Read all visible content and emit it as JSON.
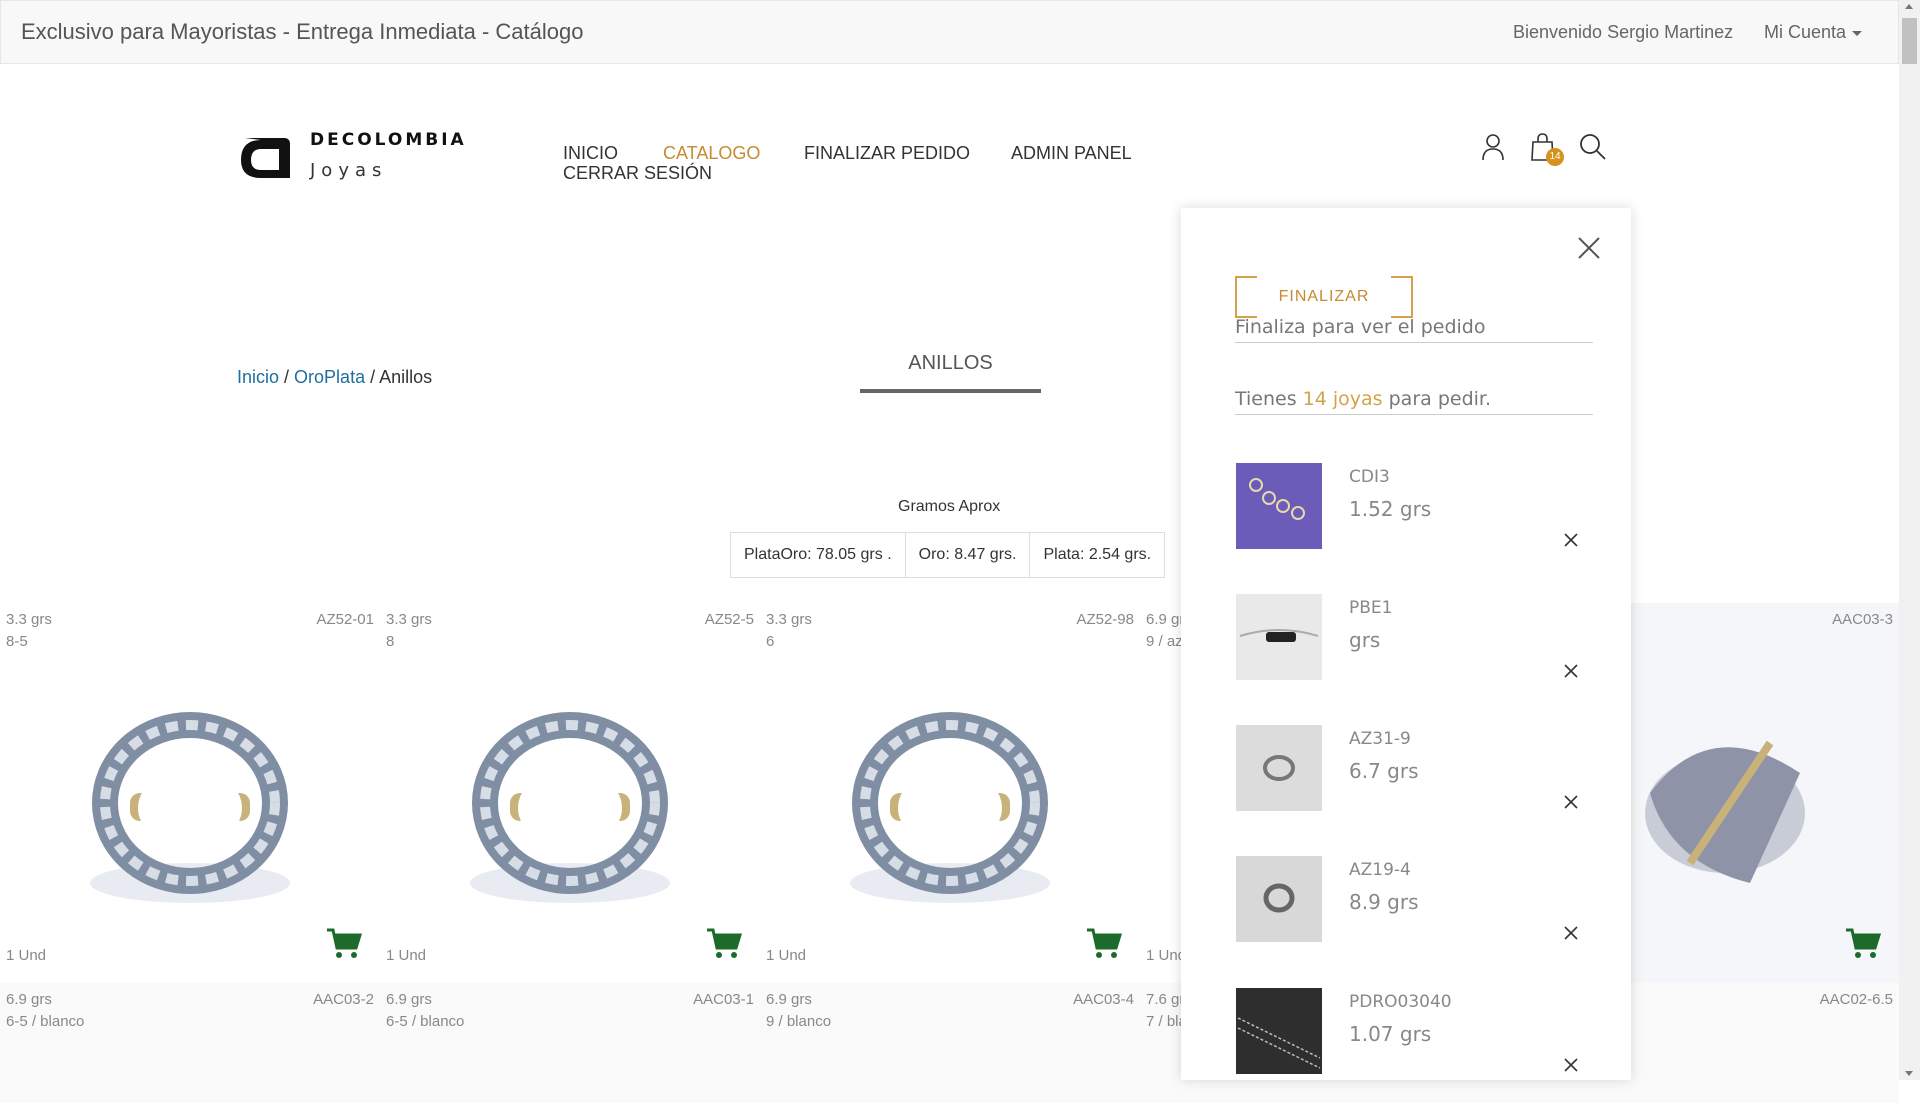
{
  "topbar": {
    "brand": "Exclusivo para Mayoristas - Entrega Inmediata - Catálogo",
    "welcome": "Bienvenido Sergio Martinez",
    "account": "Mi Cuenta"
  },
  "logo": {
    "line1": "DECOLOMBIA",
    "line2": "Joyas"
  },
  "nav": {
    "inicio": "INICIO",
    "catalogo": "CATALOGO",
    "finalizar": "FINALIZAR PEDIDO",
    "admin": "ADMIN PANEL",
    "cerrar": "CERRAR SESIÓN"
  },
  "header_icons": [
    "user-icon",
    "shopping-bag-icon",
    "search-icon"
  ],
  "cart_count": "14",
  "breadcrumb": {
    "home": "Inicio",
    "sep1": " / ",
    "section": "OroPlata",
    "sep2": " / ",
    "current": "Anillos"
  },
  "category_tab": "ANILLOS",
  "gramos": {
    "title": "Gramos Aprox",
    "cells": [
      "PlataOro: 78.05 grs .",
      "Oro: 8.47 grs.",
      "Plata: 2.54 grs."
    ]
  },
  "products": [
    {
      "weight": "3.3 grs",
      "size": "8-5",
      "code": "AZ52-01",
      "units": "1 Und"
    },
    {
      "weight": "3.3 grs",
      "size": "8",
      "code": "AZ52-5",
      "units": "1 Und"
    },
    {
      "weight": "3.3 grs",
      "size": "6",
      "code": "AZ52-98",
      "units": "1 Und"
    },
    {
      "weight": "6.9 grs",
      "size": "9 / azul",
      "code": "",
      "units": "1 Und"
    },
    {
      "weight": "",
      "size": "",
      "code": "AAC03-3",
      "units": ""
    }
  ],
  "products_row2": [
    {
      "weight": "6.9 grs",
      "size": "6-5 / blanco",
      "code": "AAC03-2"
    },
    {
      "weight": "6.9 grs",
      "size": "6-5 / blanco",
      "code": "AAC03-1"
    },
    {
      "weight": "6.9 grs",
      "size": "9 / blanco",
      "code": "AAC03-4"
    },
    {
      "weight": "7.6 grs",
      "size": "7 / blanco",
      "code": ""
    },
    {
      "weight": "",
      "size": "",
      "code": "AAC02-6.5"
    }
  ],
  "panel": {
    "finalizar_button": "FINALIZAR",
    "finalizar_hint": "Finaliza para ver el pedido",
    "count_prefix": "Tienes ",
    "count_highlight": "14 joyas",
    "count_suffix": " para pedir.",
    "items": [
      {
        "code": "CDI3",
        "grams": "1.52 grs",
        "thumb_bg": "#6a5cb8"
      },
      {
        "code": "PBE1",
        "grams": "grs",
        "thumb_bg": "#e9e9e9"
      },
      {
        "code": "AZ31-9",
        "grams": "6.7 grs",
        "thumb_bg": "#dcdcdc"
      },
      {
        "code": "AZ19-4",
        "grams": "8.9 grs",
        "thumb_bg": "#d8d8d8"
      },
      {
        "code": "PDRO03040",
        "grams": "1.07 grs",
        "thumb_bg": "#2e2e2e"
      }
    ]
  },
  "colors": {
    "accent": "#c78a30",
    "link": "#1e6f9e",
    "cart_green": "#1d6b2a",
    "badge": "#d5921e"
  }
}
